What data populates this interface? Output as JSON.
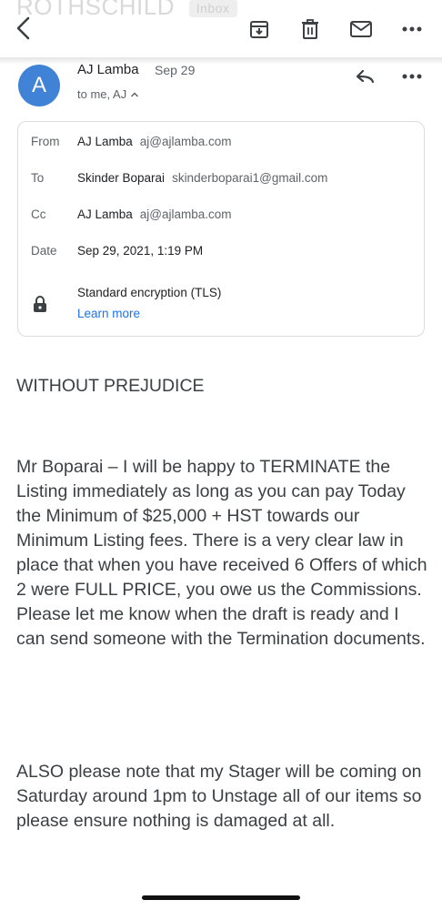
{
  "header": {
    "ghost_subject": "ROTHSCHILD",
    "ghost_label": "Inbox"
  },
  "toolbar": {
    "back_icon": "back-arrow-icon",
    "archive_icon": "archive-icon",
    "delete_icon": "trash-icon",
    "mark_unread_icon": "mail-icon",
    "more_icon": "more-horizontal-icon"
  },
  "sender": {
    "avatar_letter": "A",
    "avatar_color": "#3f82d6",
    "name": "AJ Lamba",
    "date": "Sep 29",
    "recipients": "to me, AJ",
    "expand_icon": "chevron-up-icon"
  },
  "details": {
    "from_label": "From",
    "from_name": "AJ Lamba",
    "from_email": "aj@ajlamba.com",
    "to_label": "To",
    "to_name": "Skinder Boparai",
    "to_email": "skinderboparai1@gmail.com",
    "cc_label": "Cc",
    "cc_name": "AJ Lamba",
    "cc_email": "aj@ajlamba.com",
    "date_label": "Date",
    "date_value": "Sep 29, 2021, 1:19 PM",
    "encryption": "Standard encryption (TLS)",
    "learn_more": "Learn more"
  },
  "body": {
    "p1": "WITHOUT PREJUDICE",
    "p2": "Mr Boparai – I will be happy to TERMINATE the Listing immediately as long as you can pay Today the Minimum of $25,000 + HST towards our Minimum Listing fees. There is a very clear law in place that when you have received 6 Offers of which 2 were FULL PRICE, you owe us the Commissions. Please let me know when the draft is ready and I can send someone with the Termination documents.",
    "p3": "ALSO please note that my Stager will be coming on Saturday around 1pm to Unstage all of our items so please ensure nothing is damaged at all."
  }
}
